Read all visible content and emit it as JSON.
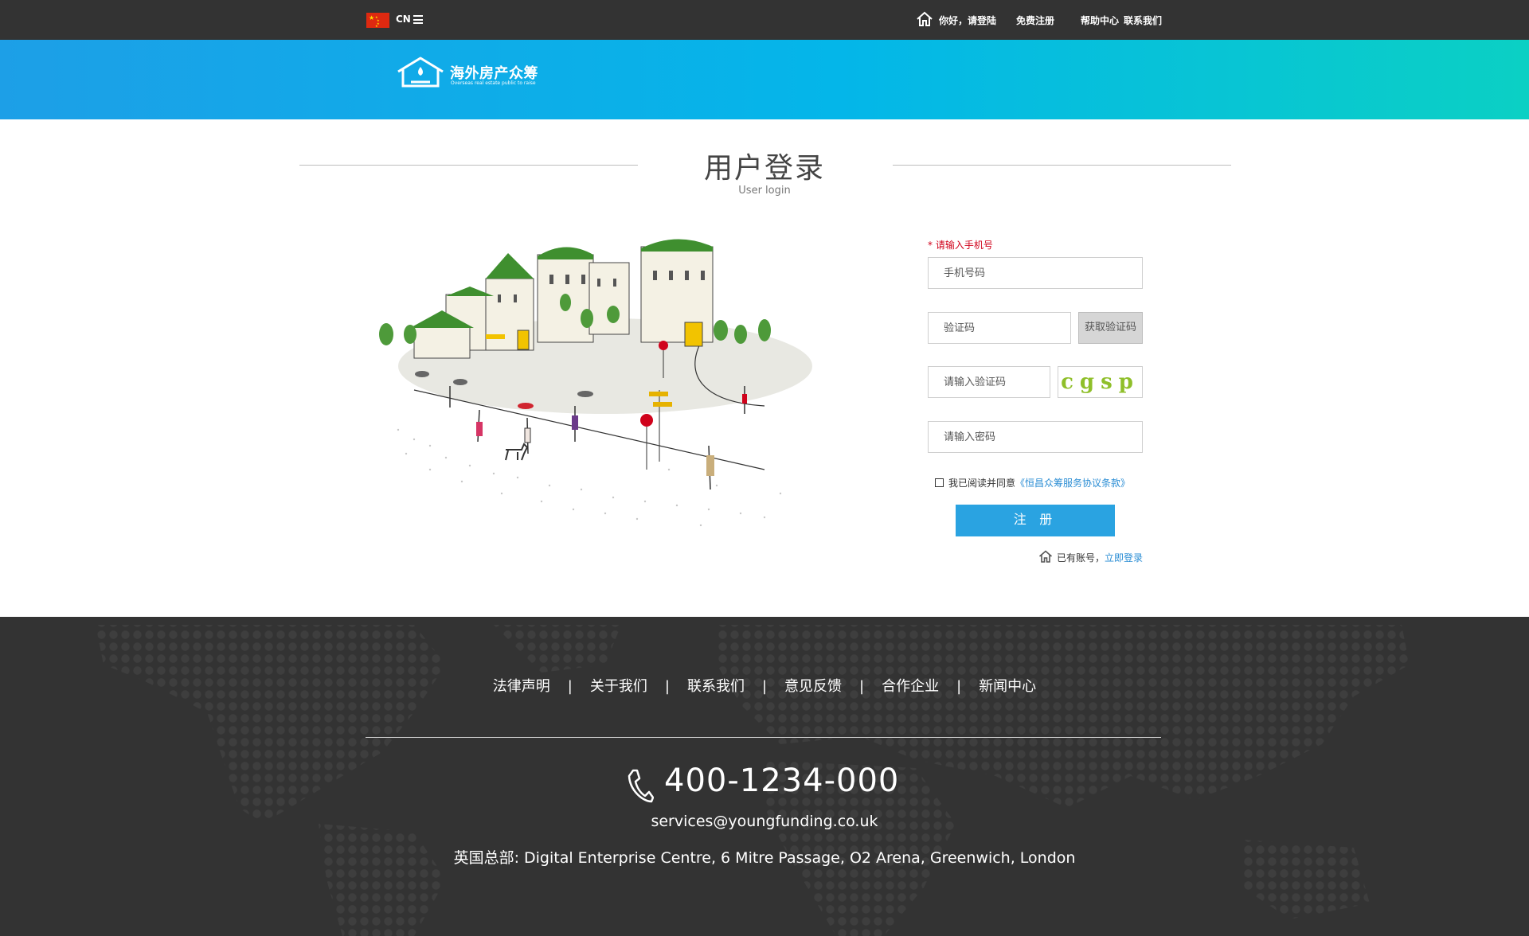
{
  "topbar": {
    "lang": "CN",
    "greeting": "你好，请登陆",
    "register": "免费注册",
    "help": "帮助中心",
    "contact": "联系我们"
  },
  "brand": {
    "title": "海外房产众筹",
    "subtitle": "Overseas real estate public to raise"
  },
  "page": {
    "title": "用户登录",
    "subtitle": "User login"
  },
  "form": {
    "required_hint": "* 请输入手机号",
    "phone_placeholder": "手机号码",
    "sms_placeholder": "验证码",
    "sms_button": "获取验证码",
    "captcha_placeholder": "请输入验证码",
    "captcha_text": "cgsp",
    "password_placeholder": "请输入密码",
    "agree_text": "我已阅读并同意",
    "agree_link": "《恒昌众筹服务协议条款》",
    "register_button": "注 册",
    "has_account": "已有账号，",
    "login_link": "立即登录"
  },
  "footer": {
    "nav": [
      "法律声明",
      "关于我们",
      "联系我们",
      "意见反馈",
      "合作企业",
      "新闻中心"
    ],
    "separator": "|",
    "phone": "400-1234-000",
    "email": "services@youngfunding.co.uk",
    "address": "英国总部: Digital Enterprise Centre, 6 Mitre Passage, O2 Arena, Greenwich, London"
  },
  "colors": {
    "topbar": "#333333",
    "banner_start": "#1d9fe7",
    "banner_end": "#0bd0c4",
    "accent": "#2aa3e1",
    "required": "#d0021b",
    "footer": "#333333"
  },
  "icons": [
    "china-flag-icon",
    "menu-icon",
    "home-icon",
    "logo-house-icon",
    "phone-icon"
  ]
}
